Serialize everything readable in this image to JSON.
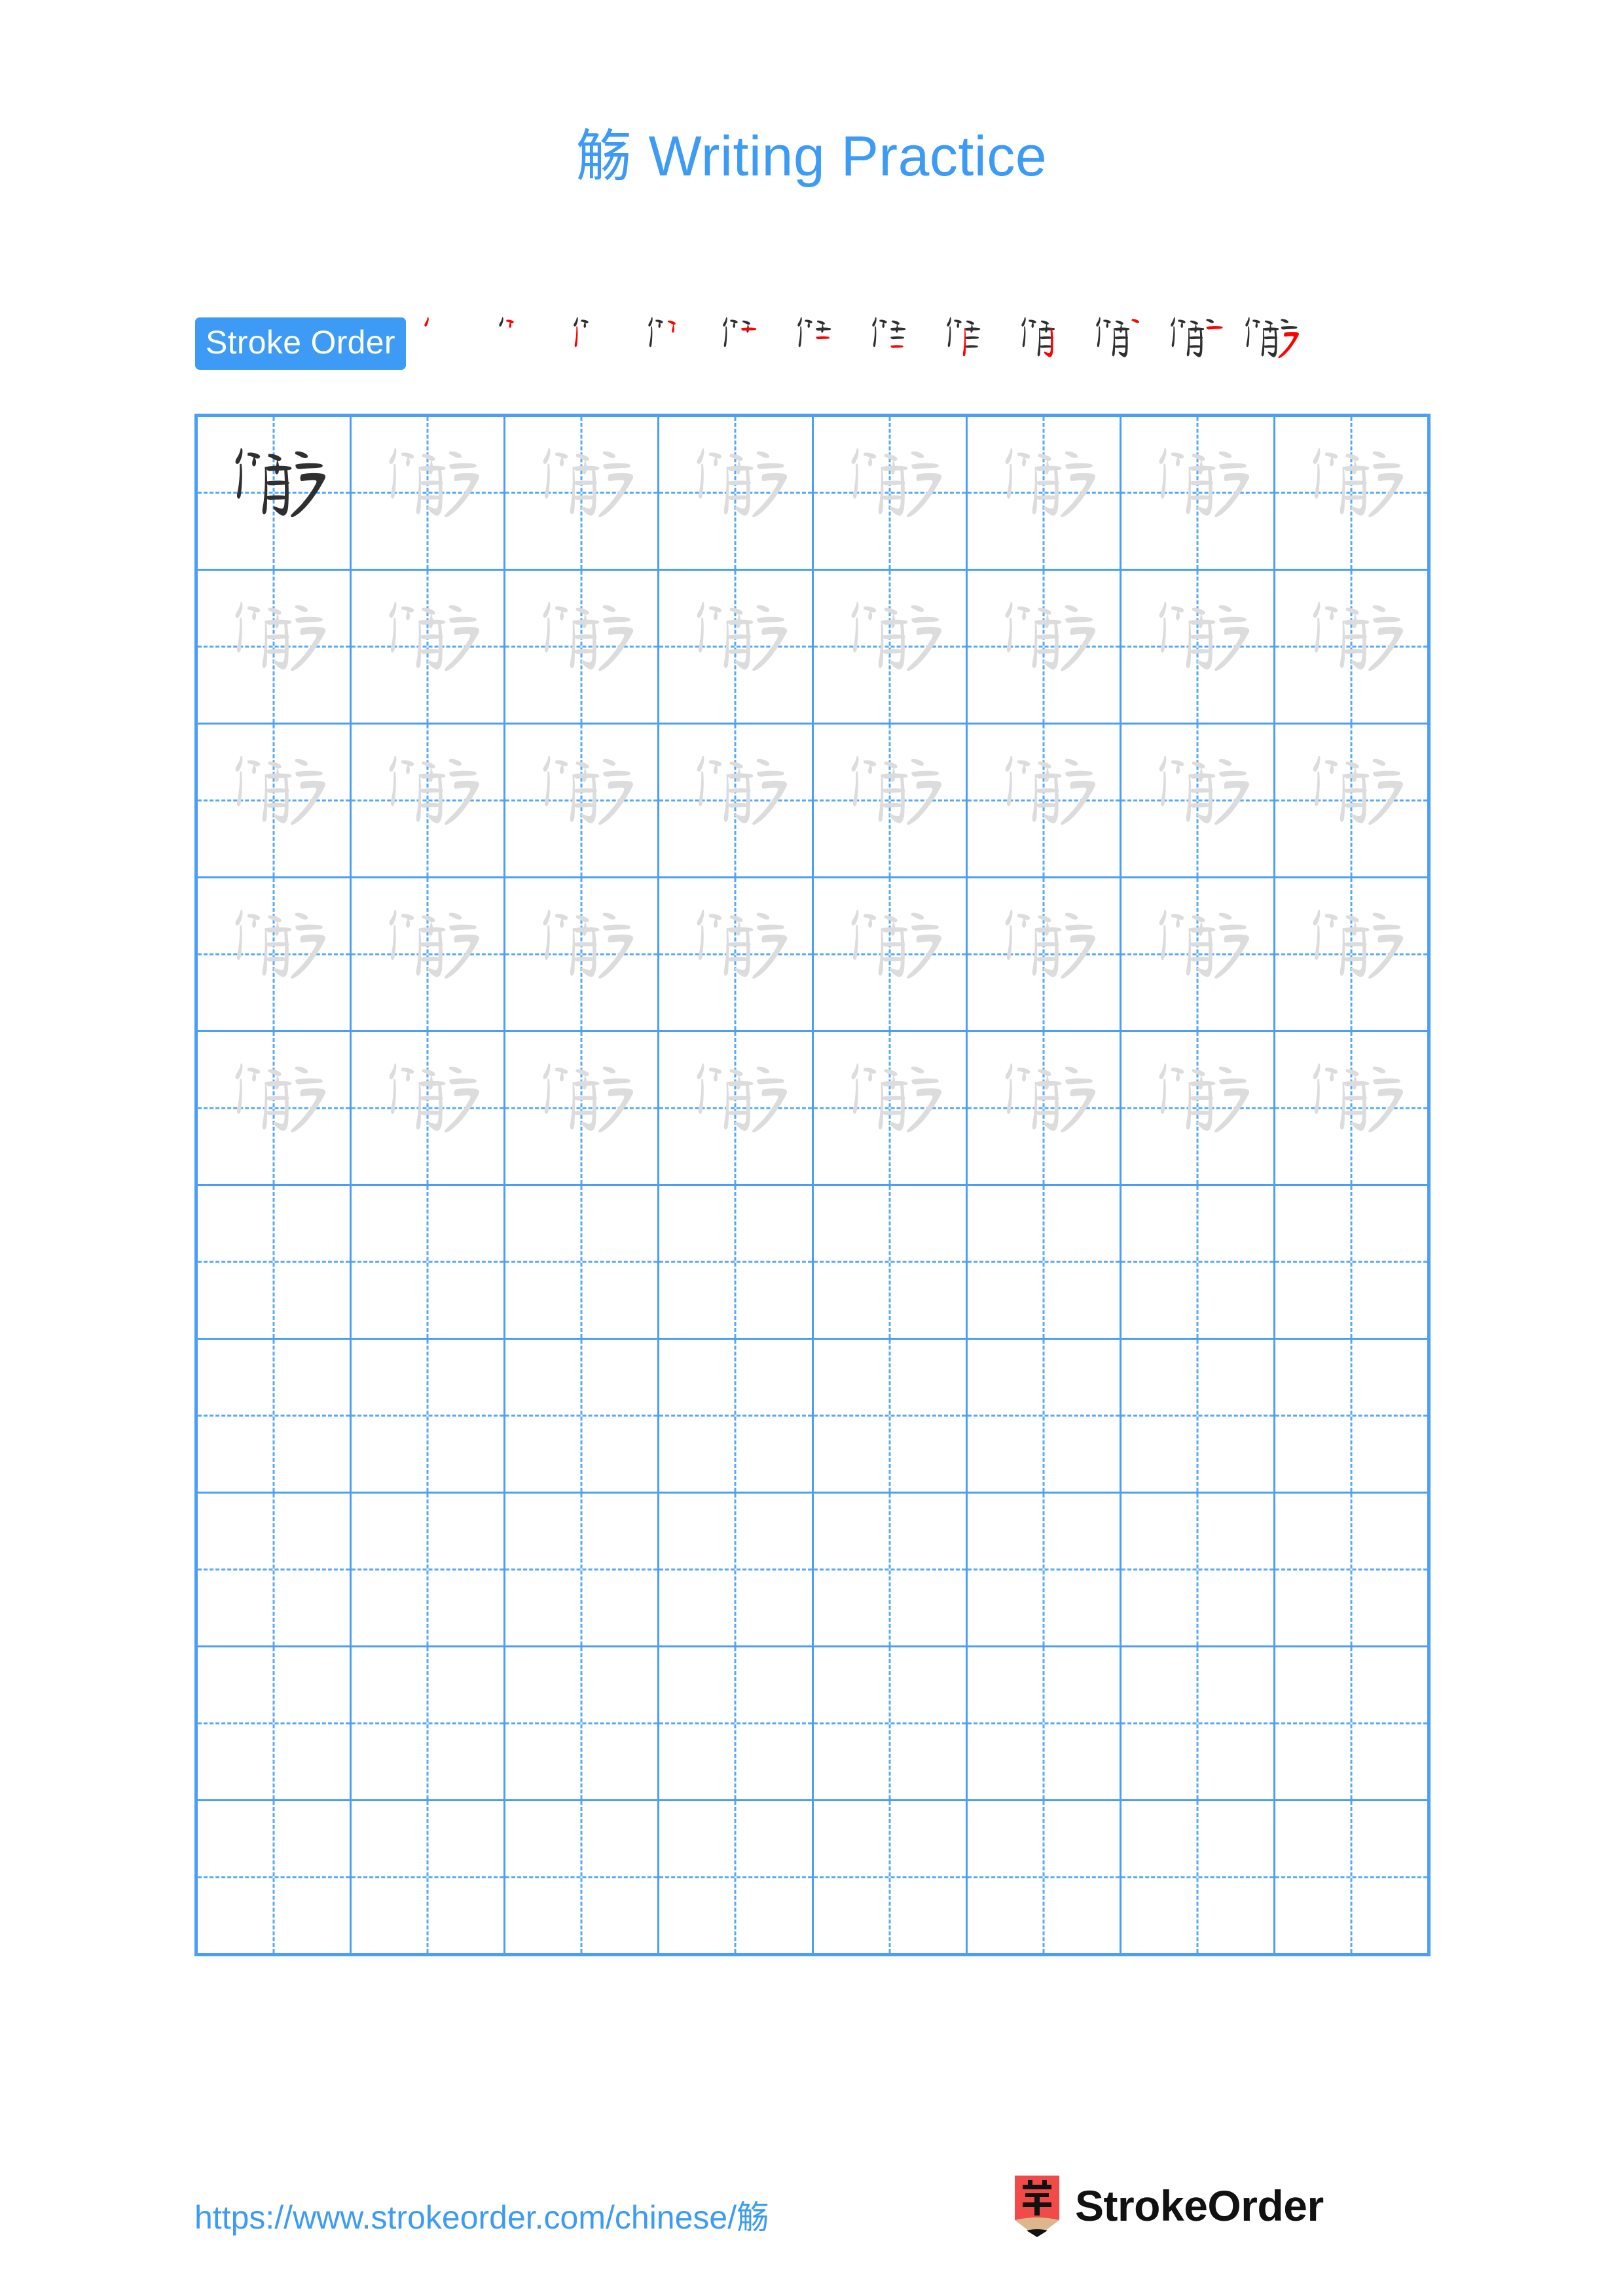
{
  "page": {
    "character": "觞",
    "background_color": "#ffffff",
    "accent_color": "#3d9bf5",
    "grid_line_color": "#4a9ef5",
    "trace_color": "#dcdcdc",
    "ink_color": "#2f2f2f",
    "stroke_highlight_color": "#ff0000"
  },
  "title": {
    "character": "觞",
    "text": " Writing Practice",
    "full": "觞 Writing Practice"
  },
  "stroke_order": {
    "badge_label": "Stroke Order",
    "total_strokes": 12,
    "steps": [
      {
        "index": 1,
        "strokes_shown": 1,
        "new_stroke_color": "#ff0000"
      },
      {
        "index": 2,
        "strokes_shown": 2,
        "new_stroke_color": "#ff0000"
      },
      {
        "index": 3,
        "strokes_shown": 3,
        "new_stroke_color": "#ff0000"
      },
      {
        "index": 4,
        "strokes_shown": 4,
        "new_stroke_color": "#ff0000"
      },
      {
        "index": 5,
        "strokes_shown": 5,
        "new_stroke_color": "#ff0000"
      },
      {
        "index": 6,
        "strokes_shown": 6,
        "new_stroke_color": "#ff0000"
      },
      {
        "index": 7,
        "strokes_shown": 7,
        "new_stroke_color": "#ff0000"
      },
      {
        "index": 8,
        "strokes_shown": 8,
        "new_stroke_color": "#ff0000"
      },
      {
        "index": 9,
        "strokes_shown": 9,
        "new_stroke_color": "#ff0000"
      },
      {
        "index": 10,
        "strokes_shown": 10,
        "new_stroke_color": "#ff0000"
      },
      {
        "index": 11,
        "strokes_shown": 11,
        "new_stroke_color": "#ff0000"
      },
      {
        "index": 12,
        "strokes_shown": 12,
        "new_stroke_color": "#ff0000"
      }
    ]
  },
  "practice_grid": {
    "columns": 8,
    "rows": 10,
    "cell_guides": "dashed-cross",
    "row_contents": [
      [
        "ink",
        "trace",
        "trace",
        "trace",
        "trace",
        "trace",
        "trace",
        "trace"
      ],
      [
        "trace",
        "trace",
        "trace",
        "trace",
        "trace",
        "trace",
        "trace",
        "trace"
      ],
      [
        "trace",
        "trace",
        "trace",
        "trace",
        "trace",
        "trace",
        "trace",
        "trace"
      ],
      [
        "trace",
        "trace",
        "trace",
        "trace",
        "trace",
        "trace",
        "trace",
        "trace"
      ],
      [
        "trace",
        "trace",
        "trace",
        "trace",
        "trace",
        "trace",
        "trace",
        "trace"
      ],
      [
        "empty",
        "empty",
        "empty",
        "empty",
        "empty",
        "empty",
        "empty",
        "empty"
      ],
      [
        "empty",
        "empty",
        "empty",
        "empty",
        "empty",
        "empty",
        "empty",
        "empty"
      ],
      [
        "empty",
        "empty",
        "empty",
        "empty",
        "empty",
        "empty",
        "empty",
        "empty"
      ],
      [
        "empty",
        "empty",
        "empty",
        "empty",
        "empty",
        "empty",
        "empty",
        "empty"
      ],
      [
        "empty",
        "empty",
        "empty",
        "empty",
        "empty",
        "empty",
        "empty",
        "empty"
      ]
    ]
  },
  "footer": {
    "url_prefix": "https://www.strokeorder.com/chinese/",
    "url_character": "觞",
    "url": "https://www.strokeorder.com/chinese/觞",
    "brand_name": "StrokeOrder",
    "logo_glyph": "字",
    "logo_color": "#f04b48",
    "logo_pencil_wood_color": "#dcb68c"
  }
}
